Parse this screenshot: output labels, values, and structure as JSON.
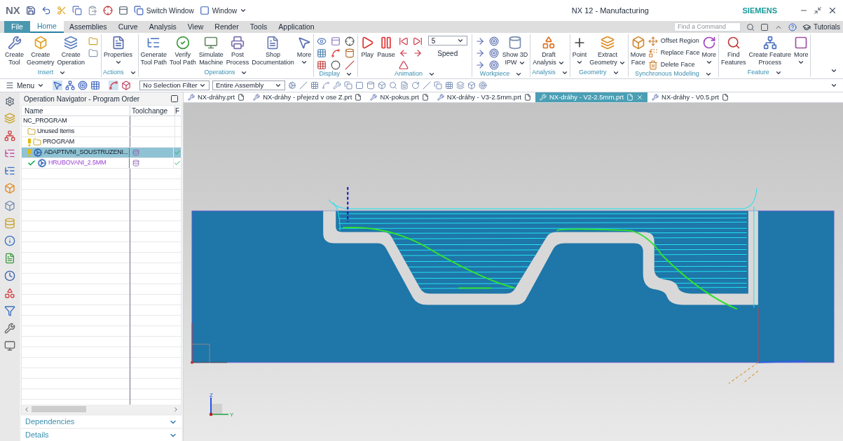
{
  "title_bar": {
    "logo": "NX",
    "switch_window": "Switch Window",
    "window_menu": "Window",
    "title": "NX 12 - Manufacturing",
    "brand": "SIEMENS"
  },
  "ribbon_tabs": [
    {
      "label": "File",
      "kind": "file",
      "selected": false
    },
    {
      "label": "Home",
      "kind": "tab",
      "selected": true
    },
    {
      "label": "Assemblies",
      "kind": "tab",
      "selected": false
    },
    {
      "label": "Curve",
      "kind": "tab",
      "selected": false
    },
    {
      "label": "Analysis",
      "kind": "tab",
      "selected": false
    },
    {
      "label": "View",
      "kind": "tab",
      "selected": false
    },
    {
      "label": "Render",
      "kind": "tab",
      "selected": false
    },
    {
      "label": "Tools",
      "kind": "tab",
      "selected": false
    },
    {
      "label": "Application",
      "kind": "tab",
      "selected": false
    }
  ],
  "command_search": {
    "placeholder": "Find a Command"
  },
  "tutorials": "Tutorials",
  "ribbon_groups": [
    {
      "label": "Insert",
      "commands": [
        {
          "kind": "large",
          "lines": [
            "Create",
            "Tool"
          ]
        },
        {
          "kind": "large",
          "lines": [
            "Create",
            "Geometry"
          ]
        },
        {
          "kind": "large",
          "lines": [
            "Create",
            "Operation"
          ]
        },
        {
          "kind": "small"
        },
        {
          "kind": "small"
        }
      ]
    },
    {
      "label": "Actions",
      "commands": [
        {
          "kind": "large",
          "lines": [
            "Properties"
          ],
          "dropdown": true
        }
      ]
    },
    {
      "label": "Operations",
      "commands": [
        {
          "kind": "large",
          "lines": [
            "Generate",
            "Tool Path"
          ]
        },
        {
          "kind": "large",
          "lines": [
            "Verify",
            "Tool Path"
          ]
        },
        {
          "kind": "large",
          "lines": [
            "Simulate",
            "Machine"
          ]
        },
        {
          "kind": "large",
          "lines": [
            "Post",
            "Process"
          ]
        },
        {
          "kind": "large",
          "lines": [
            "Shop",
            "Documentation"
          ]
        },
        {
          "kind": "large",
          "lines": [
            "More"
          ],
          "dropdown": true
        }
      ]
    },
    {
      "label": "Display",
      "commands": [
        {
          "kind": "small"
        },
        {
          "kind": "small"
        },
        {
          "kind": "small"
        },
        {
          "kind": "small"
        },
        {
          "kind": "small"
        },
        {
          "kind": "small"
        },
        {
          "kind": "small"
        },
        {
          "kind": "small"
        },
        {
          "kind": "small"
        }
      ]
    },
    {
      "label": "Animation",
      "commands": [
        {
          "kind": "large",
          "lines": [
            "Play"
          ]
        },
        {
          "kind": "large",
          "lines": [
            "Pause"
          ]
        },
        {
          "kind": "small"
        },
        {
          "kind": "small"
        },
        {
          "kind": "small"
        },
        {
          "kind": "small"
        },
        {
          "kind": "small"
        },
        {
          "kind": "speed",
          "value": "5",
          "label": "Speed"
        }
      ]
    },
    {
      "label": "Workpiece",
      "commands": [
        {
          "kind": "small"
        },
        {
          "kind": "small"
        },
        {
          "kind": "small"
        },
        {
          "kind": "small"
        },
        {
          "kind": "small"
        },
        {
          "kind": "small"
        },
        {
          "kind": "large",
          "lines": [
            "Show 3D",
            "IPW"
          ],
          "dropdown": true,
          "dropdown_inline": true
        }
      ]
    },
    {
      "label": "Analysis",
      "commands": [
        {
          "kind": "large",
          "lines": [
            "Draft",
            "Analysis"
          ],
          "dropdown": true,
          "dropdown_inline": true
        }
      ]
    },
    {
      "label": "Geometry",
      "commands": [
        {
          "kind": "large",
          "lines": [
            "Point"
          ],
          "dropdown": true
        },
        {
          "kind": "large",
          "lines": [
            "Extract",
            "Geometry"
          ],
          "dropdown": true,
          "dropdown_inline": true
        }
      ]
    },
    {
      "label": "Synchronous Modeling",
      "commands": [
        {
          "kind": "large",
          "lines": [
            "Move",
            "Face"
          ]
        },
        {
          "kind": "small",
          "label": "Offset Region"
        },
        {
          "kind": "small",
          "label": "Replace Face"
        },
        {
          "kind": "small",
          "label": "Delete Face"
        },
        {
          "kind": "large",
          "lines": [
            "More"
          ],
          "dropdown": true
        }
      ]
    },
    {
      "label": "Feature",
      "commands": [
        {
          "kind": "large",
          "lines": [
            "Find",
            "Features"
          ]
        },
        {
          "kind": "large",
          "lines": [
            "Create Feature",
            "Process"
          ]
        },
        {
          "kind": "large",
          "lines": [
            "More"
          ],
          "dropdown": true
        }
      ]
    }
  ],
  "toolbar": {
    "menu": "Menu",
    "selection_filter": "No Selection Filter",
    "assembly_scope": "Entire Assembly"
  },
  "navigator": {
    "title": "Operation Navigator - Program Order",
    "columns": [
      "Name",
      "Toolchange",
      "F"
    ],
    "rows": [
      {
        "name": "NC_PROGRAM",
        "selected": false,
        "children": [
          {
            "name": "Unused Items",
            "kind": "group",
            "flagged": false,
            "complete": false,
            "selected": false
          },
          {
            "name": "PROGRAM",
            "kind": "group",
            "flagged": true,
            "complete": false,
            "selected": false
          },
          {
            "name": "ADAPTIVNI_SOUSTRUZENI...",
            "kind": "operation",
            "flagged": true,
            "complete": false,
            "selected": true
          },
          {
            "name": "HRUBOVANI_2.5MM",
            "kind": "operation",
            "flagged": false,
            "complete": true,
            "selected": false
          }
        ]
      }
    ]
  },
  "panel_sections": [
    {
      "label": "Dependencies",
      "expanded": false
    },
    {
      "label": "Details",
      "expanded": false
    }
  ],
  "file_tabs": [
    {
      "label": "NX-dráhy.prt",
      "selected": false
    },
    {
      "label": "NX-dráhy - přejezd v ose Z.prt",
      "selected": false
    },
    {
      "label": "NX-pokus.prt",
      "selected": false
    },
    {
      "label": "NX-dráhy - V3-2.5mm.prt",
      "selected": false
    },
    {
      "label": "NX-dráhy - V2-2.5mm.prt",
      "selected": true
    },
    {
      "label": "NX-dráhy - V0.5.prt",
      "selected": false
    }
  ],
  "view_triad": {
    "axis_labels": [
      "Z",
      "Y"
    ]
  }
}
